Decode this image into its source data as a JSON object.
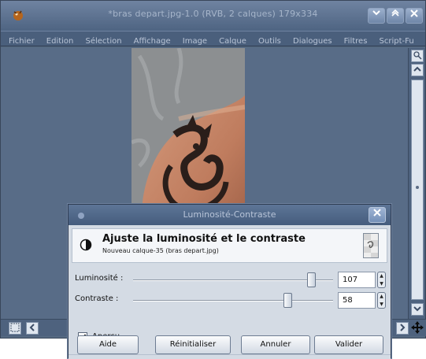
{
  "window": {
    "title": "*bras depart.jpg-1.0 (RVB, 2 calques) 179x334",
    "controls": {
      "minimize": "",
      "maximize": "",
      "close": ""
    }
  },
  "menu": [
    "Fichier",
    "Edition",
    "Sélection",
    "Affichage",
    "Image",
    "Calque",
    "Outils",
    "Dialogues",
    "Filtres",
    "Script-Fu"
  ],
  "dialog": {
    "title": "Luminosité-Contraste",
    "heading": "Ajuste la luminosité et le contraste",
    "subheading": "Nouveau calque-35 (bras depart.jpg)",
    "sliders": [
      {
        "label": "Luminosité :",
        "value": "107",
        "fraction": 0.89
      },
      {
        "label": "Contraste :",
        "value": "58",
        "fraction": 0.77
      }
    ],
    "preview": {
      "label": "Aperçu",
      "checked": true
    },
    "buttons": [
      "Aide",
      "Réinitialiser",
      "Annuler",
      "Valider"
    ]
  },
  "colors": {
    "title_bar": "#5a6f8f",
    "workspace": "#586c87",
    "dialog_body": "#d4dbe4",
    "skin": "#c98a6e",
    "tattoo": "#2a1e1a"
  }
}
